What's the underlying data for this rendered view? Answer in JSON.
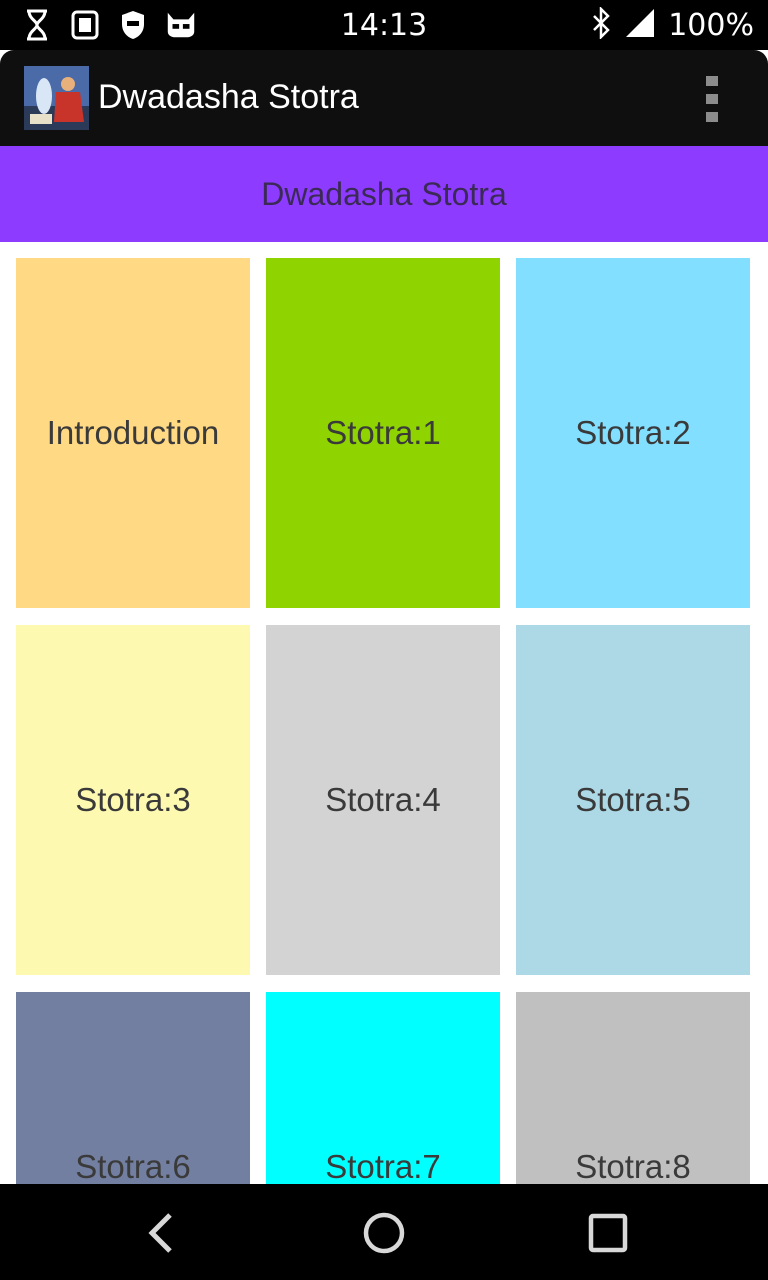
{
  "status_bar": {
    "time": "14:13",
    "battery": "100%",
    "icons": [
      "hourglass-icon",
      "sd-card-icon",
      "shield-icon",
      "cyanogen-icon",
      "bluetooth-icon",
      "signal-icon"
    ]
  },
  "app_bar": {
    "title": "Dwadasha Stotra",
    "logo": "app-logo-image",
    "menu_icon": "overflow-menu-icon"
  },
  "header": {
    "title": "Dwadasha Stotra",
    "color": "#8c3bff"
  },
  "tiles": [
    {
      "label": "Introduction",
      "color": "#ffd983"
    },
    {
      "label": "Stotra:1",
      "color": "#8fd400"
    },
    {
      "label": "Stotra:2",
      "color": "#82dfff"
    },
    {
      "label": "Stotra:3",
      "color": "#fdf9b0"
    },
    {
      "label": "Stotra:4",
      "color": "#d3d3d3"
    },
    {
      "label": "Stotra:5",
      "color": "#add8e6"
    },
    {
      "label": "Stotra:6",
      "color": "#737fa1"
    },
    {
      "label": "Stotra:7",
      "color": "#00ffff"
    },
    {
      "label": "Stotra:8",
      "color": "#c0c0c0"
    }
  ],
  "nav_bar": {
    "icons": [
      "back-icon",
      "home-icon",
      "recent-apps-icon"
    ]
  }
}
